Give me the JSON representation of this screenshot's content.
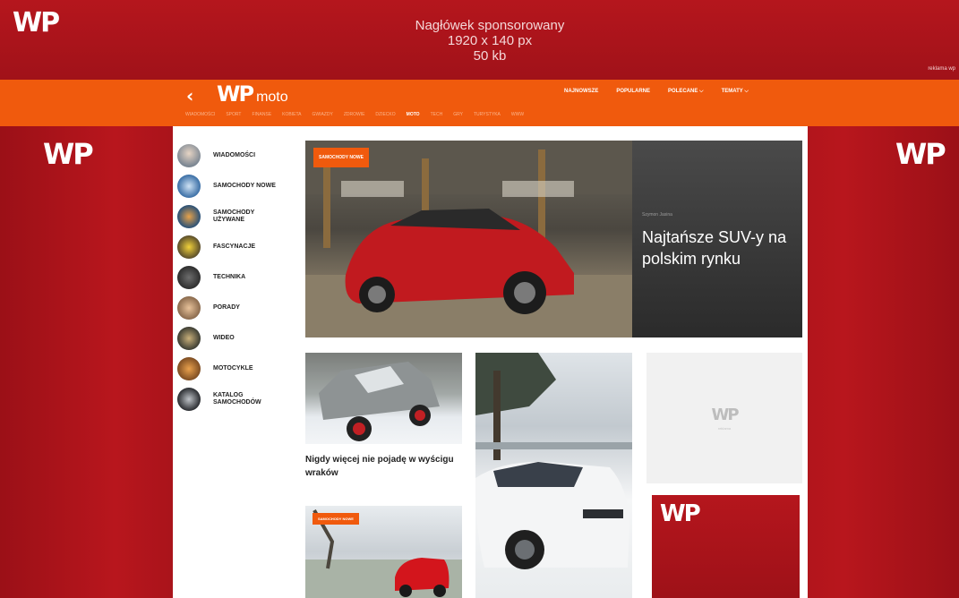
{
  "sponsor": {
    "logo": "WP",
    "line1": "Nagłówek sponsorowany",
    "line2": "1920 x 140 px",
    "line3": "50 kb",
    "small": "reklama wp"
  },
  "nav": {
    "back_icon": "chevron-left-icon",
    "logo": "WP",
    "logo_suffix": "moto",
    "top_links": [
      "NAJNOWSZE",
      "POPULARNE",
      "POLECANE ⌵",
      "TEMATY ⌵"
    ],
    "sub_links": [
      "WIADOMOŚCI",
      "SPORT",
      "FINANSE",
      "KOBIETA",
      "GWIAZDY",
      "ZDROWIE",
      "DZIECKO",
      "MOTO",
      "TECH",
      "GRY",
      "TURYSTYKA",
      "WWW"
    ],
    "sub_active": "MOTO"
  },
  "side_logos": {
    "left": "WP",
    "right": "WP"
  },
  "categories": [
    {
      "label": "WIADOMOŚCI"
    },
    {
      "label": "SAMOCHODY NOWE"
    },
    {
      "label": "SAMOCHODY UŻYWANE"
    },
    {
      "label": "FASCYNACJE"
    },
    {
      "label": "TECHNIKA"
    },
    {
      "label": "PORADY"
    },
    {
      "label": "WIDEO"
    },
    {
      "label": "MOTOCYKLE"
    },
    {
      "label": "KATALOG SAMOCHODÓW"
    }
  ],
  "hero": {
    "badge": "SAMOCHODY NOWE",
    "kicker": "Szymon Jasina",
    "title": "Najtańsze SUV-y na polskim rynku"
  },
  "card1": {
    "title": "Nigdy więcej nie pojadę w wyścigu wraków"
  },
  "card2": {
    "badge": "SAMOCHODY NOWE"
  },
  "ad1": {
    "logo": "WP",
    "small": "reklama"
  },
  "ad2": {
    "logo": "WP"
  },
  "colors": {
    "brand_red": "#a81319",
    "nav_orange": "#f05a0d"
  }
}
